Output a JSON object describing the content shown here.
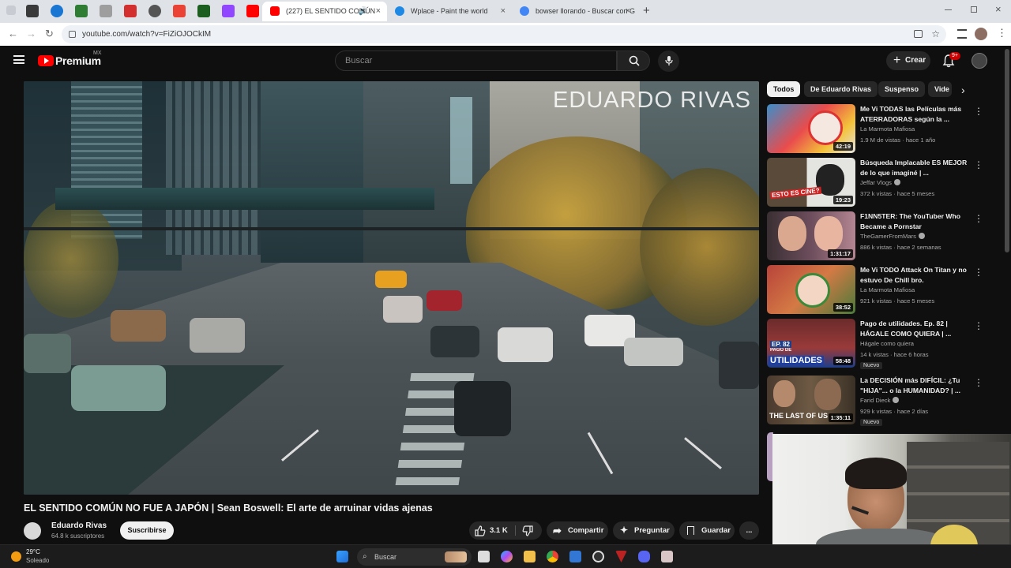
{
  "browser": {
    "tabs": [
      {
        "label": "(227) EL SENTIDO COMÚN",
        "active": true
      },
      {
        "label": "Wplace - Paint the world",
        "active": false
      },
      {
        "label": "bowser llorando - Buscar con G",
        "active": false
      }
    ],
    "url": "youtube.com/watch?v=FiZiOJOCkIM",
    "new_tab": "+"
  },
  "youtube": {
    "logo_text": "Premium",
    "country_code": "MX",
    "search_placeholder": "Buscar",
    "create_label": "Crear",
    "notification_count": "9+"
  },
  "video": {
    "watermark": "EDUARDO RIVAS",
    "title": "EL SENTIDO COMÚN NO FUE A JAPÓN | Sean Boswell: El arte de arruinar vidas ajenas",
    "channel": "Eduardo Rivas",
    "subscribers": "64.8 k suscriptores",
    "subscribe_label": "Suscribirse",
    "likes": "3.1 K",
    "share_label": "Compartir",
    "ask_label": "Preguntar",
    "save_label": "Guardar",
    "more": "..."
  },
  "chips": [
    "Todos",
    "De Eduardo Rivas",
    "Suspenso",
    "Vide"
  ],
  "recommendations": [
    {
      "title": "Me Vi TODAS las Películas más ATERRADORAS según la ...",
      "channel": "La Marmota Mafiosa",
      "meta": "1.9 M de vistas · hace 1 año",
      "duration": "42:19",
      "verified": false,
      "new": ""
    },
    {
      "title": "Búsqueda Implacable ES MEJOR de lo que imaginé | ...",
      "channel": "Jeffar Vlogs",
      "meta": "372 k vistas · hace 5 meses",
      "duration": "19:23",
      "verified": true,
      "new": ""
    },
    {
      "title": "F1NN5TER: The YouTuber Who Became a Pornstar",
      "channel": "TheGamerFromMars",
      "meta": "886 k vistas · hace 2 semanas",
      "duration": "1:31:17",
      "verified": true,
      "new": ""
    },
    {
      "title": "Me Vi TODO Attack On Titan y no estuvo De Chill bro.",
      "channel": "La Marmota Mafiosa",
      "meta": "921 k vistas · hace 5 meses",
      "duration": "38:52",
      "verified": false,
      "new": ""
    },
    {
      "title": "Pago de utilidades. Ep. 82 | HÁGALE COMO QUIERA | ...",
      "channel": "Hágale como quiera",
      "meta": "14 k vistas · hace 6 horas",
      "duration": "58:48",
      "verified": false,
      "new": "Nuevo"
    },
    {
      "title": "La DECISIÓN más DIFÍCIL: ¿Tu \"HIJA\"... o la HUMANIDAD? | ...",
      "channel": "Farid Dieck",
      "meta": "929 k vistas · hace 2 días",
      "duration": "1:35:11",
      "verified": true,
      "new": "Nuevo"
    }
  ],
  "thumb_text": {
    "t2": "ESTO ES CINE?",
    "t5": "UTILIDADES",
    "t5b": "EP. 82",
    "t5c": "PAGO DE",
    "t6": "THE LAST OF US"
  },
  "taskbar": {
    "temperature": "29°C",
    "condition": "Soleado",
    "search_label": "Buscar"
  },
  "colors": {
    "yt_red": "#ff0000",
    "background": "#0f0f0f",
    "chip_bg": "#272727"
  }
}
